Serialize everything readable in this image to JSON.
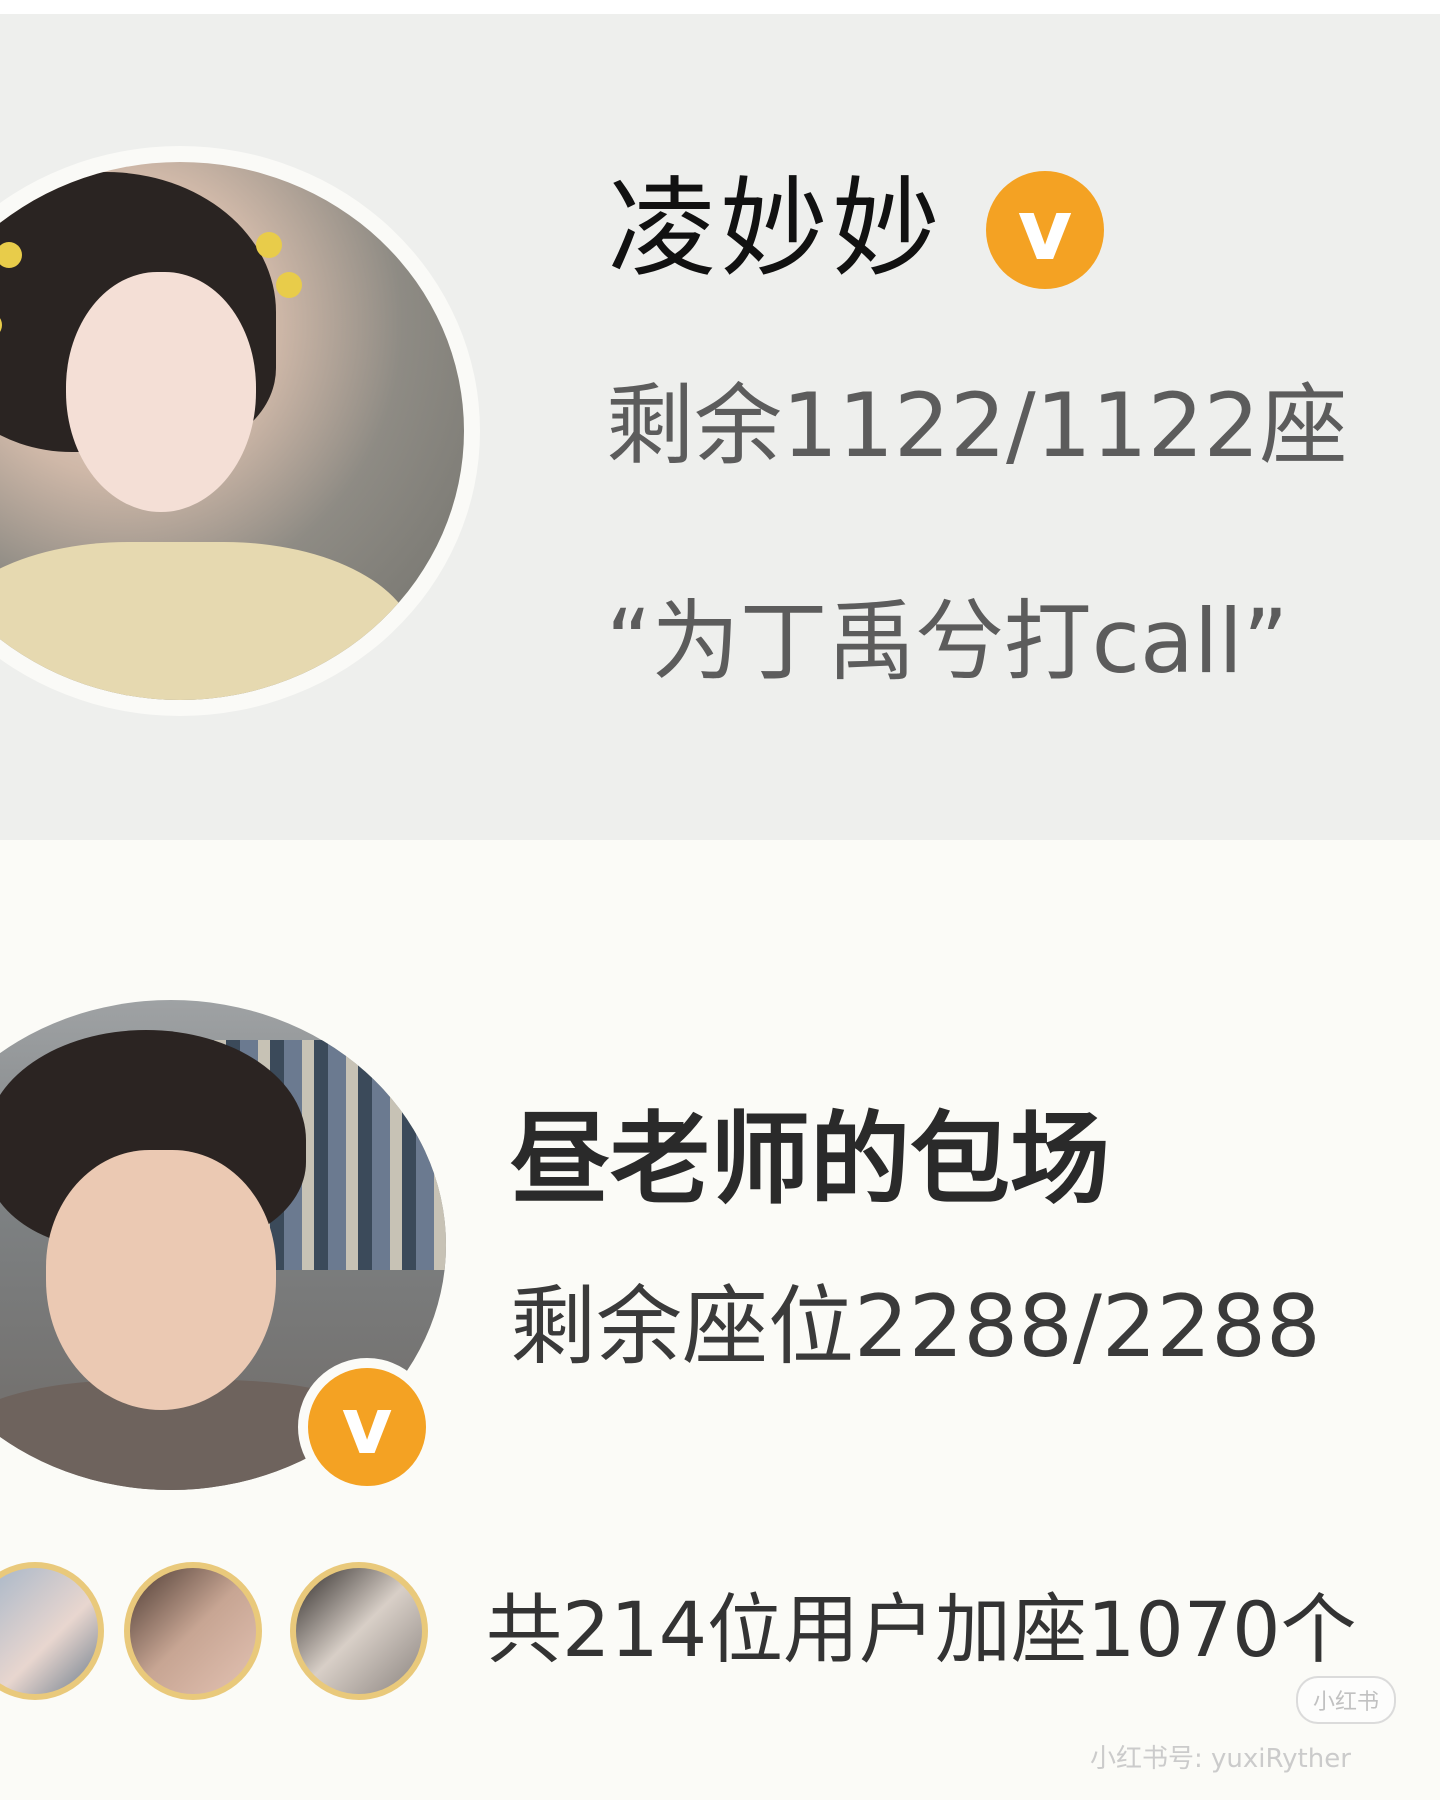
{
  "top_card": {
    "name": "凌妙妙",
    "badge_icon": "v",
    "seats_text": "剩余1122/1122座",
    "quote_text": "“为丁禹兮打call”"
  },
  "bottom_card": {
    "name": "昼老师的包场",
    "badge_icon": "v",
    "seats_text": "剩余座位2288/2288",
    "summary_text": "共214位用户加座1070个"
  },
  "watermark": {
    "logo_text": "小红书",
    "account_text": "小红书号: yuxiRyther"
  },
  "colors": {
    "badge": "#f4a223",
    "top_card_bg": "#eeefed",
    "bottom_card_bg": "#fbfbf7"
  }
}
